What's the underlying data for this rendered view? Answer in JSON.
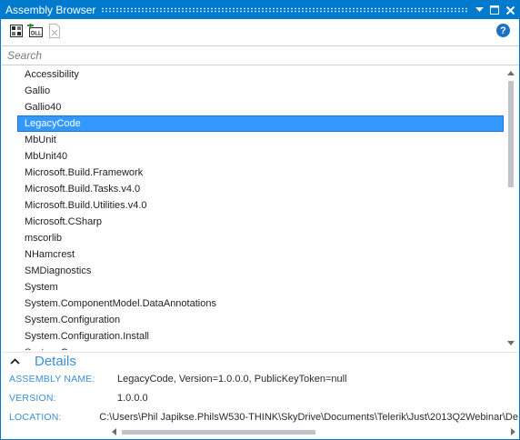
{
  "window": {
    "title": "Assembly Browser",
    "accent_color": "#007acc"
  },
  "toolbar": {
    "buttons": [
      {
        "icon": "open-assembly-icon"
      },
      {
        "icon": "add-dll-icon"
      },
      {
        "icon": "remove-assembly-icon"
      }
    ],
    "add_dll_label": "DLL",
    "help_label": "?"
  },
  "search": {
    "placeholder": "Search",
    "value": ""
  },
  "assemblies": {
    "selected_color": "#3399ff",
    "selected": "LegacyCode",
    "items": [
      "Accessibility",
      "Gallio",
      "Gallio40",
      "LegacyCode",
      "MbUnit",
      "MbUnit40",
      "Microsoft.Build.Framework",
      "Microsoft.Build.Tasks.v4.0",
      "Microsoft.Build.Utilities.v4.0",
      "Microsoft.CSharp",
      "mscorlib",
      "NHamcrest",
      "SMDiagnostics",
      "System",
      "System.ComponentModel.DataAnnotations",
      "System.Configuration",
      "System.Configuration.Install",
      "System.Core"
    ]
  },
  "details": {
    "title": "Details",
    "label_color": "#3a8fd6",
    "assembly_name_label": "ASSEMBLY NAME:",
    "assembly_name_value": "LegacyCode, Version=1.0.0.0, PublicKeyToken=null",
    "version_label": "VERSION:",
    "version_value": "1.0.0.0",
    "location_label": "LOCATION:",
    "location_value": "C:\\Users\\Phil Japikse.PhilsW530-THINK\\SkyDrive\\Documents\\Telerik\\Just\\2013Q2Webinar\\De"
  }
}
